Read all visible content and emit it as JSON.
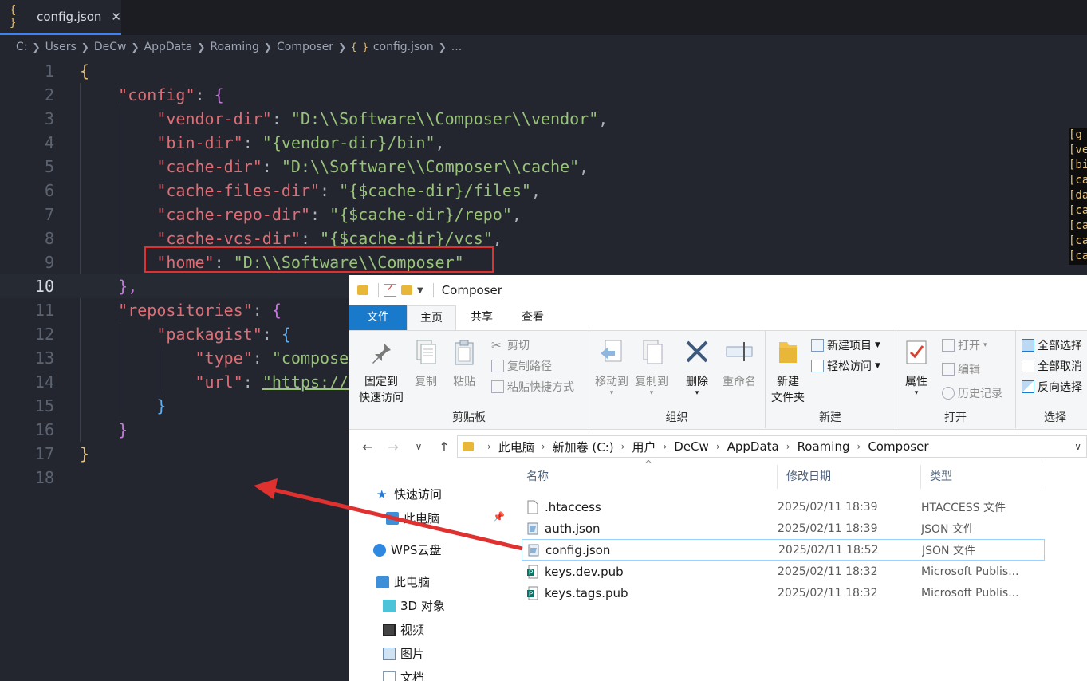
{
  "editor": {
    "tab": {
      "icon": "{ }",
      "label": "config.json",
      "close": "✕"
    },
    "breadcrumb": [
      "C:",
      "Users",
      "DeCw",
      "AppData",
      "Roaming",
      "Composer"
    ],
    "breadcrumb_file_icon": "{ }",
    "breadcrumb_file": "config.json",
    "breadcrumb_more": "...",
    "line_numbers": [
      "1",
      "2",
      "3",
      "4",
      "5",
      "6",
      "7",
      "8",
      "9",
      "10",
      "11",
      "12",
      "13",
      "14",
      "15",
      "16",
      "17",
      "18"
    ],
    "current_line": "10",
    "code": {
      "l1": "{",
      "l2_key": "\"config\"",
      "l2_rest": ": ",
      "l2_brace": "{",
      "l3_key": "\"vendor-dir\"",
      "l3_val": "\"D:\\\\Software\\\\Composer\\\\vendor\"",
      "l4_key": "\"bin-dir\"",
      "l4_val": "\"{vendor-dir}/bin\"",
      "l5_key": "\"cache-dir\"",
      "l5_val": "\"D:\\\\Software\\\\Composer\\\\cache\"",
      "l6_key": "\"cache-files-dir\"",
      "l6_val": "\"{$cache-dir}/files\"",
      "l7_key": "\"cache-repo-dir\"",
      "l7_val": "\"{$cache-dir}/repo\"",
      "l8_key": "\"cache-vcs-dir\"",
      "l8_val": "\"{$cache-dir}/vcs\"",
      "l9_key": "\"home\"",
      "l9_val": "\"D:\\\\Software\\\\Composer\"",
      "l10": "},",
      "l11_key": "\"repositories\"",
      "l11_brace": "{",
      "l12_key": "\"packagist\"",
      "l12_brace": "{",
      "l13_key": "\"type\"",
      "l13_val": "\"compose",
      "l14_key": "\"url\"",
      "l14_val": "\"https://",
      "l15": "}",
      "l16": "}",
      "l17": "}"
    },
    "minimap": [
      "[g",
      "[ve",
      "[bi",
      "[ca",
      "[da",
      "[ca",
      "[ca",
      "[ca",
      "[ca"
    ]
  },
  "explorer": {
    "title": "Composer",
    "ribbon_tabs": [
      "文件",
      "主页",
      "共享",
      "查看"
    ],
    "clipboard": {
      "pin_label_1": "固定到",
      "pin_label_2": "快速访问",
      "copy": "复制",
      "paste": "粘贴",
      "cut": "剪切",
      "copy_path": "复制路径",
      "paste_shortcut": "粘贴快捷方式",
      "group": "剪贴板"
    },
    "organize": {
      "move_to": "移动到",
      "copy_to": "复制到",
      "delete": "删除",
      "rename": "重命名",
      "group": "组织"
    },
    "new": {
      "new_folder_1": "新建",
      "new_folder_2": "文件夹",
      "new_item": "新建项目",
      "easy_access": "轻松访问",
      "group": "新建"
    },
    "open": {
      "properties": "属性",
      "open": "打开",
      "edit": "编辑",
      "history": "历史记录",
      "group": "打开"
    },
    "select": {
      "select_all": "全部选择",
      "select_none": "全部取消",
      "invert": "反向选择",
      "group": "选择"
    },
    "address": [
      "此电脑",
      "新加卷 (C:)",
      "用户",
      "DeCw",
      "AppData",
      "Roaming",
      "Composer"
    ],
    "nav_pane": [
      "快速访问",
      "此电脑",
      "WPS云盘",
      "此电脑",
      "3D 对象",
      "视频",
      "图片",
      "文档"
    ],
    "columns": {
      "name": "名称",
      "date": "修改日期",
      "type": "类型"
    },
    "files": [
      {
        "name": ".htaccess",
        "date": "2025/02/11 18:39",
        "type": "HTACCESS 文件"
      },
      {
        "name": "auth.json",
        "date": "2025/02/11 18:39",
        "type": "JSON 文件"
      },
      {
        "name": "config.json",
        "date": "2025/02/11 18:52",
        "type": "JSON 文件"
      },
      {
        "name": "keys.dev.pub",
        "date": "2025/02/11 18:32",
        "type": "Microsoft Publis..."
      },
      {
        "name": "keys.tags.pub",
        "date": "2025/02/11 18:32",
        "type": "Microsoft Publis..."
      }
    ]
  },
  "colors": {
    "highlight": "#e03131",
    "accent": "#1979ca",
    "editor_bg": "#23262e"
  }
}
